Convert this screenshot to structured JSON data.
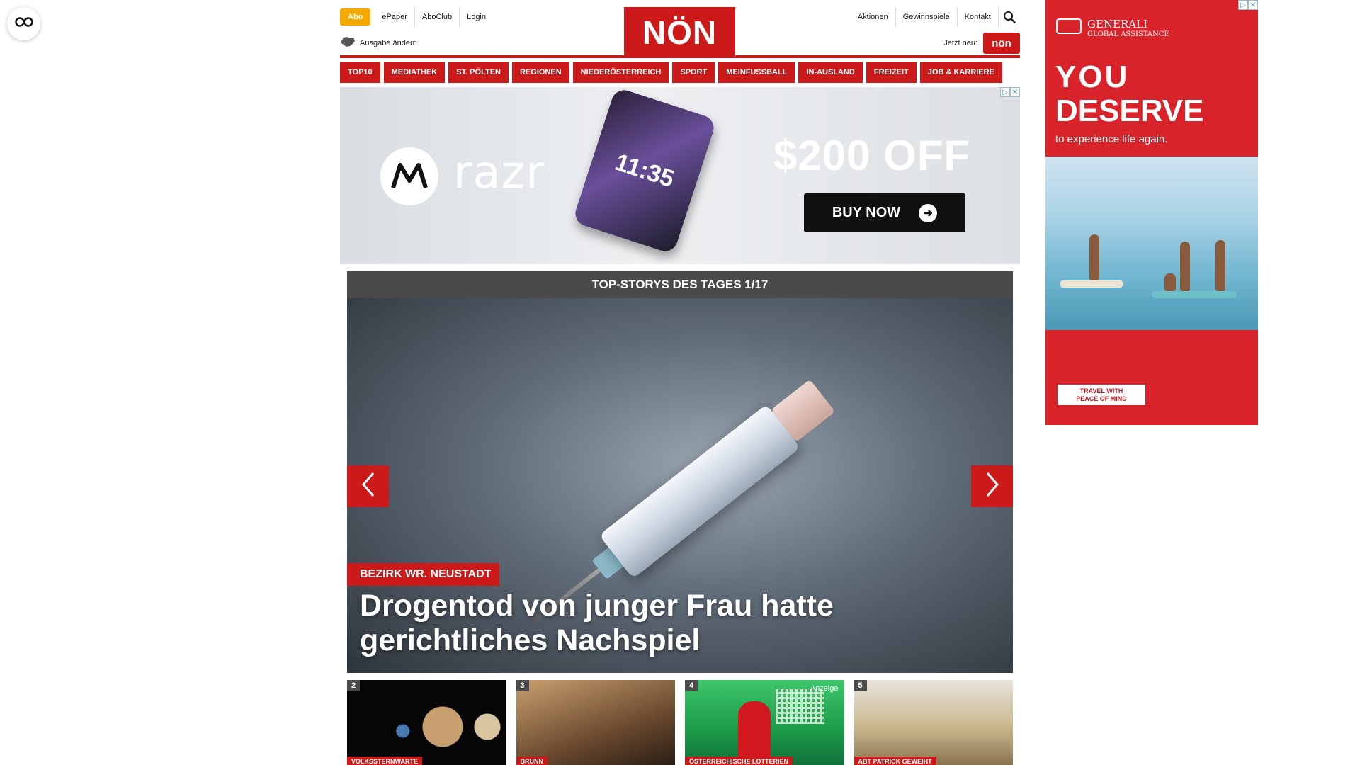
{
  "header": {
    "abo_label": "Abo",
    "links_left": [
      "ePaper",
      "AboClub",
      "Login"
    ],
    "ausgabe_label": "Ausgabe ändern",
    "logo_text": "NÖN",
    "links_right": [
      "Aktionen",
      "Gewinnspiele",
      "Kontakt"
    ],
    "jetzt_label": "Jetzt neu:",
    "jetzt_badge": "nön"
  },
  "nav": {
    "items": [
      "TOP10",
      "MEDIATHEK",
      "ST. PÖLTEN",
      "REGIONEN",
      "NIEDERÖSTERREICH",
      "SPORT",
      "MEINFUSSBALL",
      "IN-AUSLAND",
      "FREIZEIT",
      "JOB & KARRIERE"
    ]
  },
  "banner_ad": {
    "brand": "razr",
    "phone_time": "11:35",
    "promo": "$200 OFF",
    "cta": "BUY NOW"
  },
  "carousel": {
    "heading": "TOP-STORYS DES TAGES 1/17",
    "kicker": "BEZIRK WR. NEUSTADT",
    "headline": "Drogentod von junger Frau hatte gerichtliches Nachspiel"
  },
  "thumbs": [
    {
      "num": "2",
      "tag": "VOLKSSTERNWARTE",
      "anzeige": ""
    },
    {
      "num": "3",
      "tag": "BRUNN",
      "anzeige": ""
    },
    {
      "num": "4",
      "tag": "ÖSTERREICHISCHE LOTTERIEN",
      "anzeige": "Anzeige"
    },
    {
      "num": "5",
      "tag": "ABT PATRICK GEWEIHT",
      "anzeige": ""
    }
  ],
  "side_ad": {
    "brand_line1": "GENERALI",
    "brand_line2": "GLOBAL ASSISTANCE",
    "headline_1": "YOU",
    "headline_2": "DESERVE",
    "subline": "to experience life again.",
    "cta_1": "TRAVEL WITH",
    "cta_2": "PEACE OF MIND"
  },
  "colors": {
    "brand_red": "#cc1a1a",
    "abo_orange": "#f2a900",
    "generali_red": "#d8232a"
  }
}
